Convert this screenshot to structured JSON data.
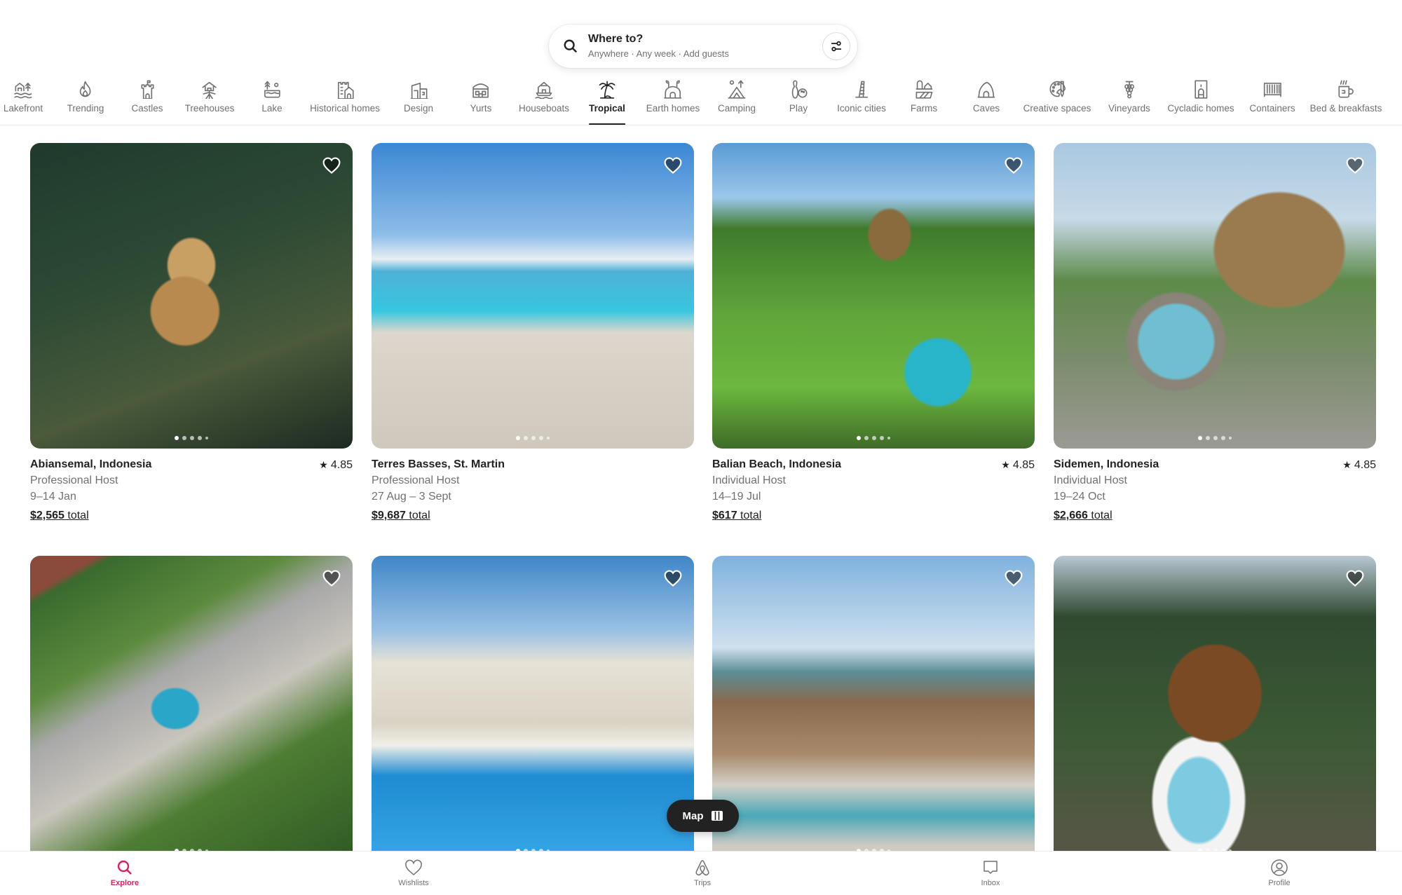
{
  "search": {
    "title": "Where to?",
    "subtitle": "Anywhere · Any week · Add guests",
    "icon": "search-icon",
    "filter_icon": "filters-icon"
  },
  "categories": [
    {
      "label": "Lakefront",
      "icon": "lakefront-icon",
      "active": false
    },
    {
      "label": "Trending",
      "icon": "flame-icon",
      "active": false
    },
    {
      "label": "Castles",
      "icon": "castle-icon",
      "active": false
    },
    {
      "label": "Treehouses",
      "icon": "treehouse-icon",
      "active": false
    },
    {
      "label": "Lake",
      "icon": "lake-icon",
      "active": false
    },
    {
      "label": "Historical homes",
      "icon": "historical-home-icon",
      "active": false
    },
    {
      "label": "Design",
      "icon": "design-icon",
      "active": false
    },
    {
      "label": "Yurts",
      "icon": "yurt-icon",
      "active": false
    },
    {
      "label": "Houseboats",
      "icon": "houseboat-icon",
      "active": false
    },
    {
      "label": "Tropical",
      "icon": "palm-tree-icon",
      "active": true
    },
    {
      "label": "Earth homes",
      "icon": "earth-home-icon",
      "active": false
    },
    {
      "label": "Camping",
      "icon": "tent-icon",
      "active": false
    },
    {
      "label": "Play",
      "icon": "bowling-icon",
      "active": false
    },
    {
      "label": "Iconic cities",
      "icon": "leaning-tower-icon",
      "active": false
    },
    {
      "label": "Farms",
      "icon": "barn-icon",
      "active": false
    },
    {
      "label": "Caves",
      "icon": "cave-icon",
      "active": false
    },
    {
      "label": "Creative spaces",
      "icon": "palette-icon",
      "active": false
    },
    {
      "label": "Vineyards",
      "icon": "grapes-icon",
      "active": false
    },
    {
      "label": "Cycladic homes",
      "icon": "cycladic-home-icon",
      "active": false
    },
    {
      "label": "Containers",
      "icon": "container-icon",
      "active": false
    },
    {
      "label": "Bed & breakfasts",
      "icon": "mug-icon",
      "active": false
    }
  ],
  "listings": [
    {
      "location": "Abiansemal, Indonesia",
      "host": "Professional Host",
      "dates": "9–14 Jan",
      "price": "$2,565",
      "price_suffix": " total",
      "rating": "4.85",
      "photo_count": 5,
      "photo_index": 1
    },
    {
      "location": "Terres Basses, St. Martin",
      "host": "Professional Host",
      "dates": "27 Aug – 3 Sept",
      "price": "$9,687",
      "price_suffix": " total",
      "rating": null,
      "photo_count": 5,
      "photo_index": 1
    },
    {
      "location": "Balian Beach, Indonesia",
      "host": "Individual Host",
      "dates": "14–19 Jul",
      "price": "$617",
      "price_suffix": " total",
      "rating": "4.85",
      "photo_count": 5,
      "photo_index": 1
    },
    {
      "location": "Sidemen, Indonesia",
      "host": "Individual Host",
      "dates": "19–24 Oct",
      "price": "$2,666",
      "price_suffix": " total",
      "rating": "4.85",
      "photo_count": 5,
      "photo_index": 1
    },
    {
      "photo_count": 5,
      "photo_index": 1
    },
    {
      "photo_count": 5,
      "photo_index": 1
    },
    {
      "photo_count": 5,
      "photo_index": 1
    },
    {
      "photo_count": 5,
      "photo_index": 1
    }
  ],
  "map_button": {
    "label": "Map",
    "icon": "map-icon"
  },
  "bottom_nav": [
    {
      "label": "Explore",
      "icon": "search-icon",
      "active": true
    },
    {
      "label": "Wishlists",
      "icon": "heart-icon",
      "active": false
    },
    {
      "label": "Trips",
      "icon": "airbnb-logo-icon",
      "active": false
    },
    {
      "label": "Inbox",
      "icon": "message-icon",
      "active": false
    },
    {
      "label": "Profile",
      "icon": "profile-icon",
      "active": false
    }
  ],
  "colors": {
    "brand": "#e31c5f",
    "text": "#222222",
    "muted": "#717171"
  }
}
